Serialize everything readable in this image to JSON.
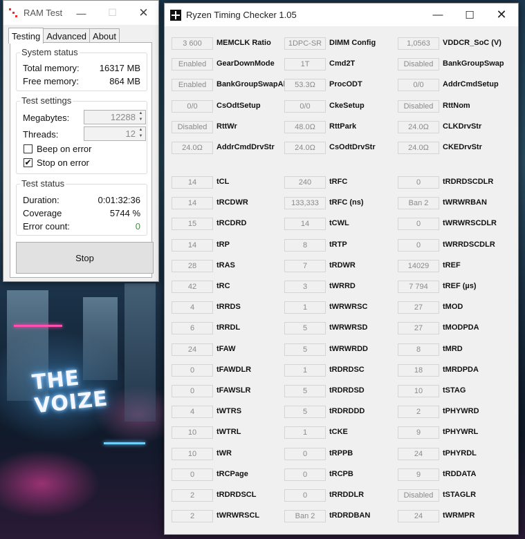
{
  "wallpaper": {
    "sign_text": "THE\nVOIZE"
  },
  "ramtest": {
    "title": "RAM Test",
    "tabs": [
      "Testing",
      "Advanced",
      "About"
    ],
    "system_status": {
      "title": "System status",
      "total_label": "Total memory:",
      "total_value": "16317 MB",
      "free_label": "Free memory:",
      "free_value": "864 MB"
    },
    "test_settings": {
      "title": "Test settings",
      "megabytes_label": "Megabytes:",
      "megabytes_value": "12288",
      "threads_label": "Threads:",
      "threads_value": "12",
      "beep_label": "Beep on error",
      "beep_checked": false,
      "stop_label": "Stop on error",
      "stop_checked": true
    },
    "test_status": {
      "title": "Test status",
      "duration_label": "Duration:",
      "duration_value": "0:01:32:36",
      "coverage_label": "Coverage",
      "coverage_value": "5744 %",
      "errors_label": "Error count:",
      "errors_value": "0"
    },
    "stop_button": "Stop"
  },
  "rtc": {
    "title": "Ryzen Timing Checker 1.05",
    "config": [
      [
        {
          "v": "3 600",
          "l": "MEMCLK Ratio"
        },
        {
          "v": "1DPC-SR",
          "l": "DIMM Config"
        },
        {
          "v": "1,0563",
          "l": "VDDCR_SoC (V)"
        }
      ],
      [
        {
          "v": "Enabled",
          "l": "GearDownMode"
        },
        {
          "v": "1T",
          "l": "Cmd2T"
        },
        {
          "v": "Disabled",
          "l": "BankGroupSwap"
        }
      ],
      [
        {
          "v": "Enabled",
          "l": "BankGroupSwapAlt"
        },
        {
          "v": "53.3Ω",
          "l": "ProcODT"
        },
        {
          "v": "0/0",
          "l": "AddrCmdSetup"
        }
      ],
      [
        {
          "v": "0/0",
          "l": "CsOdtSetup"
        },
        {
          "v": "0/0",
          "l": "CkeSetup"
        },
        {
          "v": "Disabled",
          "l": "RttNom"
        }
      ],
      [
        {
          "v": "Disabled",
          "l": "RttWr"
        },
        {
          "v": "48.0Ω",
          "l": "RttPark"
        },
        {
          "v": "24.0Ω",
          "l": "CLKDrvStr"
        }
      ],
      [
        {
          "v": "24.0Ω",
          "l": "AddrCmdDrvStr"
        },
        {
          "v": "24.0Ω",
          "l": "CsOdtDrvStr"
        },
        {
          "v": "24.0Ω",
          "l": "CKEDrvStr"
        }
      ]
    ],
    "timings": [
      [
        {
          "v": "14",
          "l": "tCL"
        },
        {
          "v": "240",
          "l": "tRFC"
        },
        {
          "v": "0",
          "l": "tRDRDSCDLR"
        }
      ],
      [
        {
          "v": "14",
          "l": "tRCDWR"
        },
        {
          "v": "133,333",
          "l": "tRFC (ns)"
        },
        {
          "v": "Ban 2",
          "l": "tWRWRBAN"
        }
      ],
      [
        {
          "v": "15",
          "l": "tRCDRD"
        },
        {
          "v": "14",
          "l": "tCWL"
        },
        {
          "v": "0",
          "l": "tWRWRSCDLR"
        }
      ],
      [
        {
          "v": "14",
          "l": "tRP"
        },
        {
          "v": "8",
          "l": "tRTP"
        },
        {
          "v": "0",
          "l": "tWRRDSCDLR"
        }
      ],
      [
        {
          "v": "28",
          "l": "tRAS"
        },
        {
          "v": "7",
          "l": "tRDWR"
        },
        {
          "v": "14029",
          "l": "tREF"
        }
      ],
      [
        {
          "v": "42",
          "l": "tRC"
        },
        {
          "v": "3",
          "l": "tWRRD"
        },
        {
          "v": "7 794",
          "l": "tREF (µs)"
        }
      ],
      [
        {
          "v": "4",
          "l": "tRRDS"
        },
        {
          "v": "1",
          "l": "tWRWRSC"
        },
        {
          "v": "27",
          "l": "tMOD"
        }
      ],
      [
        {
          "v": "6",
          "l": "tRRDL"
        },
        {
          "v": "5",
          "l": "tWRWRSD"
        },
        {
          "v": "27",
          "l": "tMODPDA"
        }
      ],
      [
        {
          "v": "24",
          "l": "tFAW"
        },
        {
          "v": "5",
          "l": "tWRWRDD"
        },
        {
          "v": "8",
          "l": "tMRD"
        }
      ],
      [
        {
          "v": "0",
          "l": "tFAWDLR"
        },
        {
          "v": "1",
          "l": "tRDRDSC"
        },
        {
          "v": "18",
          "l": "tMRDPDA"
        }
      ],
      [
        {
          "v": "0",
          "l": "tFAWSLR"
        },
        {
          "v": "5",
          "l": "tRDRDSD"
        },
        {
          "v": "10",
          "l": "tSTAG"
        }
      ],
      [
        {
          "v": "4",
          "l": "tWTRS"
        },
        {
          "v": "5",
          "l": "tRDRDDD"
        },
        {
          "v": "2",
          "l": "tPHYWRD"
        }
      ],
      [
        {
          "v": "10",
          "l": "tWTRL"
        },
        {
          "v": "1",
          "l": "tCKE"
        },
        {
          "v": "9",
          "l": "tPHYWRL"
        }
      ],
      [
        {
          "v": "10",
          "l": "tWR"
        },
        {
          "v": "0",
          "l": "tRPPB"
        },
        {
          "v": "24",
          "l": "tPHYRDL"
        }
      ],
      [
        {
          "v": "0",
          "l": "tRCPage"
        },
        {
          "v": "0",
          "l": "tRCPB"
        },
        {
          "v": "9",
          "l": "tRDDATA"
        }
      ],
      [
        {
          "v": "2",
          "l": "tRDRDSCL"
        },
        {
          "v": "0",
          "l": "tRRDDLR"
        },
        {
          "v": "Disabled",
          "l": "tSTAGLR"
        }
      ],
      [
        {
          "v": "2",
          "l": "tWRWRSCL"
        },
        {
          "v": "Ban 2",
          "l": "tRDRDBAN"
        },
        {
          "v": "24",
          "l": "tWRMPR"
        }
      ]
    ]
  }
}
